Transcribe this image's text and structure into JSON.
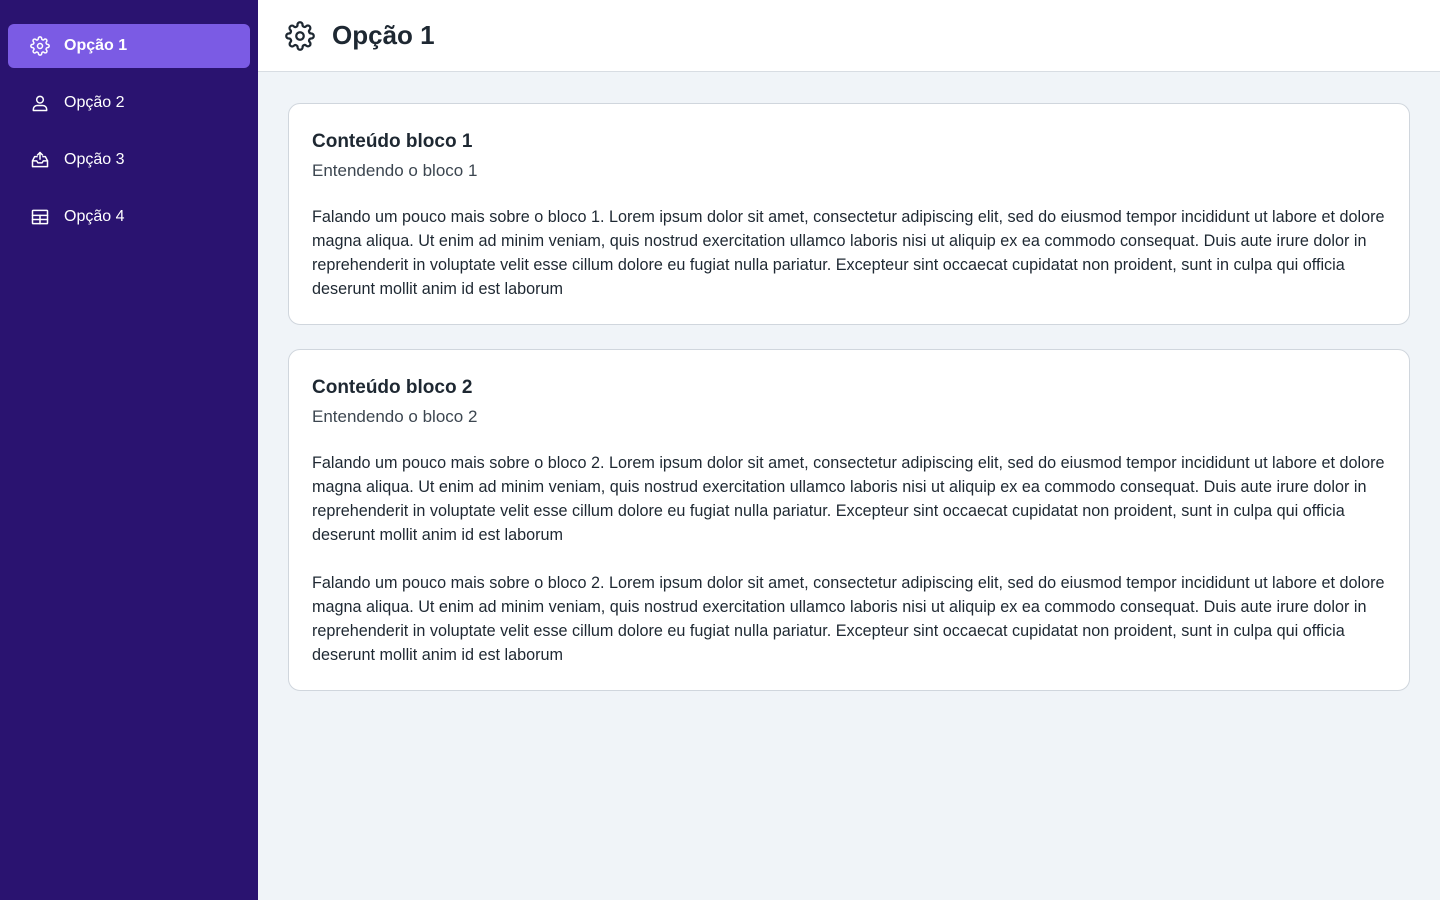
{
  "sidebar": {
    "items": [
      {
        "label": "Opção 1",
        "icon": "gear-icon"
      },
      {
        "label": "Opção 2",
        "icon": "user-icon"
      },
      {
        "label": "Opção 3",
        "icon": "upload-tray-icon"
      },
      {
        "label": "Opção 4",
        "icon": "table-icon"
      }
    ]
  },
  "header": {
    "title": "Opção 1",
    "icon": "gear-icon"
  },
  "blocks": [
    {
      "title": "Conteúdo bloco 1",
      "subtitle": "Entendendo o bloco 1",
      "paragraphs": [
        "Falando um pouco mais sobre o bloco 1. Lorem ipsum dolor sit amet, consectetur adipiscing elit, sed do eiusmod tempor incididunt ut labore et dolore magna aliqua. Ut enim ad minim veniam, quis nostrud exercitation ullamco laboris nisi ut aliquip ex ea commodo consequat. Duis aute irure dolor in reprehenderit in voluptate velit esse cillum dolore eu fugiat nulla pariatur. Excepteur sint occaecat cupidatat non proident, sunt in culpa qui officia deserunt mollit anim id est laborum"
      ]
    },
    {
      "title": "Conteúdo bloco 2",
      "subtitle": "Entendendo o bloco 2",
      "paragraphs": [
        "Falando um pouco mais sobre o bloco 2. Lorem ipsum dolor sit amet, consectetur adipiscing elit, sed do eiusmod tempor incididunt ut labore et dolore magna aliqua. Ut enim ad minim veniam, quis nostrud exercitation ullamco laboris nisi ut aliquip ex ea commodo consequat. Duis aute irure dolor in reprehenderit in voluptate velit esse cillum dolore eu fugiat nulla pariatur. Excepteur sint occaecat cupidatat non proident, sunt in culpa qui officia deserunt mollit anim id est laborum",
        "Falando um pouco mais sobre o bloco 2. Lorem ipsum dolor sit amet, consectetur adipiscing elit, sed do eiusmod tempor incididunt ut labore et dolore magna aliqua. Ut enim ad minim veniam, quis nostrud exercitation ullamco laboris nisi ut aliquip ex ea commodo consequat. Duis aute irure dolor in reprehenderit in voluptate velit esse cillum dolore eu fugiat nulla pariatur. Excepteur sint occaecat cupidatat non proident, sunt in culpa qui officia deserunt mollit anim id est laborum"
      ]
    }
  ],
  "colors": {
    "sidebar_bg": "#2a1370",
    "active_item_bg": "#7b5be4",
    "page_bg": "#f0f4f8"
  }
}
